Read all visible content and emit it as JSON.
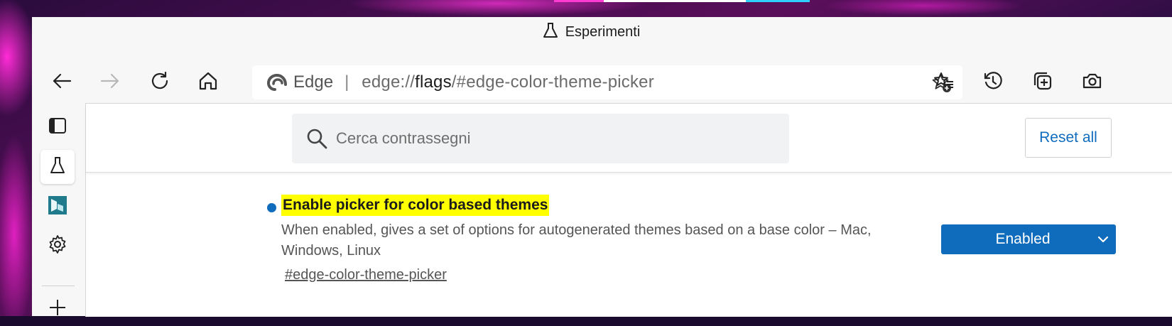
{
  "window": {
    "title": "Esperimenti"
  },
  "toolbar": {
    "back": "back-arrow-icon",
    "forward": "forward-arrow-icon",
    "refresh": "refresh-icon",
    "home": "home-icon",
    "favorites": "favorites-icon",
    "history": "history-icon",
    "collections": "collections-icon",
    "screenshot": "web-capture-icon"
  },
  "address_bar": {
    "site_label": "Edge",
    "separator": "|",
    "url_scheme": "edge://",
    "url_host": "flags",
    "url_rest": "/#edge-color-theme-picker"
  },
  "sidebar": {
    "items": [
      "vertical-tabs-icon",
      "flask-icon",
      "bing-icon",
      "gear-icon",
      "plus-icon"
    ]
  },
  "flags_page": {
    "search_placeholder": "Cerca contrassegni",
    "reset_label": "Reset all"
  },
  "flag": {
    "title": "Enable picker for color based themes",
    "description": "When enabled, gives a set of options for autogenerated themes based on a base color – Mac, Windows, Linux",
    "link": "#edge-color-theme-picker",
    "state": "Enabled"
  },
  "colors": {
    "accent": "#0f6cbd",
    "highlight": "#ffff00"
  }
}
